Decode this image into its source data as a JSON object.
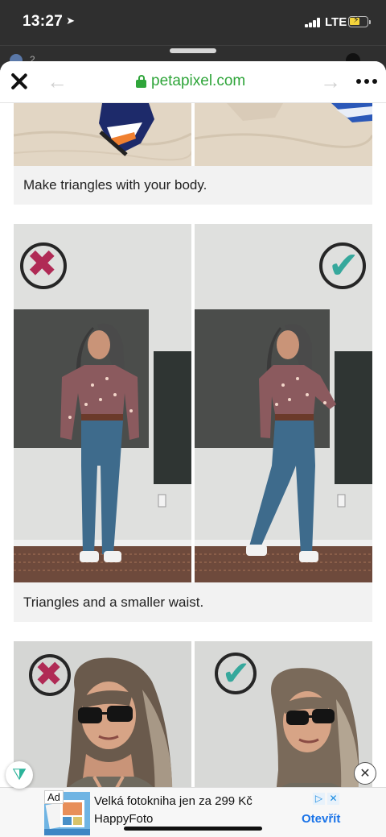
{
  "status_bar": {
    "time": "13:27",
    "network": "LTE"
  },
  "background_app": {
    "label": "2"
  },
  "browser": {
    "url": "petapixel.com"
  },
  "article": {
    "cards": [
      {
        "caption": "Make triangles with your body."
      },
      {
        "caption": "Triangles and a smaller waist.",
        "left_verdict": "wrong",
        "right_verdict": "correct"
      },
      {
        "left_verdict": "wrong",
        "right_verdict": "correct"
      }
    ]
  },
  "ad": {
    "label": "Ad",
    "title": "Velká fotokniha jen za 299 Kč",
    "advertiser": "HappyFoto",
    "cta": "Otevřít"
  },
  "colors": {
    "url_green": "#2fa53a",
    "wrong_mark": "#b02a55",
    "correct_mark": "#36a89c",
    "cta_blue": "#1a73e8"
  }
}
